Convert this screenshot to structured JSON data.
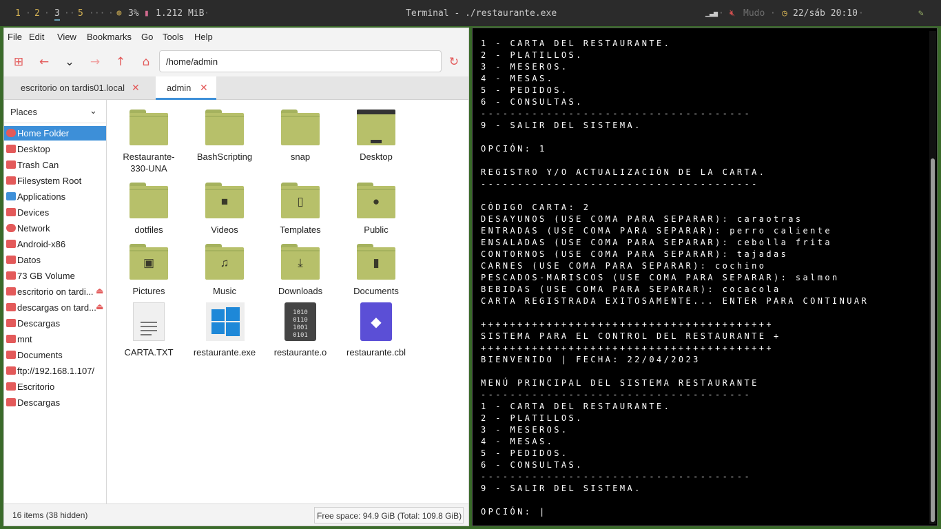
{
  "topbar": {
    "workspaces": [
      "1",
      "2",
      "3",
      "5"
    ],
    "active_workspace": "3",
    "cpu": "3%",
    "memory": "1.212 MiB",
    "window_title": "Terminal - ./restaurante.exe",
    "volume": "Mudo",
    "datetime": "22/sáb 20:10"
  },
  "file_manager": {
    "menu": [
      "File",
      "Edit",
      "View",
      "Bookmarks",
      "Go",
      "Tools",
      "Help"
    ],
    "address": "/home/admin",
    "tabs": [
      "escritorio on tardis01.local",
      "admin"
    ],
    "places_header": "Places",
    "places": [
      {
        "label": "Home Folder",
        "icon": "home-icon",
        "selected": true
      },
      {
        "label": "Desktop",
        "icon": "desktop-icon"
      },
      {
        "label": "Trash Can",
        "icon": "trash-icon"
      },
      {
        "label": "Filesystem Root",
        "icon": "folder-icon"
      },
      {
        "label": "Applications",
        "icon": "applications-icon"
      },
      {
        "label": "Devices",
        "icon": "monitor-icon"
      },
      {
        "label": "Network",
        "icon": "network-icon"
      },
      {
        "label": "Android-x86",
        "icon": "drive-icon"
      },
      {
        "label": "Datos",
        "icon": "drive-icon"
      },
      {
        "label": "73 GB Volume",
        "icon": "drive-icon"
      },
      {
        "label": "escritorio on tardi...",
        "icon": "network-share-icon",
        "eject": true
      },
      {
        "label": "descargas on tard...",
        "icon": "network-share-icon",
        "eject": true
      },
      {
        "label": "Descargas",
        "icon": "folder-icon"
      },
      {
        "label": "mnt",
        "icon": "folder-icon"
      },
      {
        "label": "Documents",
        "icon": "folder-icon"
      },
      {
        "label": "ftp://192.168.1.107/",
        "icon": "folder-icon"
      },
      {
        "label": "Escritorio",
        "icon": "folder-icon"
      },
      {
        "label": "Descargas",
        "icon": "folder-icon"
      }
    ],
    "items": [
      {
        "label": "Restaurante-330-UNA",
        "type": "folder"
      },
      {
        "label": "BashScripting",
        "type": "folder"
      },
      {
        "label": "snap",
        "type": "folder"
      },
      {
        "label": "Desktop",
        "type": "desktop-folder"
      },
      {
        "label": "dotfiles",
        "type": "folder"
      },
      {
        "label": "Videos",
        "type": "videos-folder"
      },
      {
        "label": "Templates",
        "type": "templates-folder"
      },
      {
        "label": "Public",
        "type": "public-folder"
      },
      {
        "label": "Pictures",
        "type": "pictures-folder"
      },
      {
        "label": "Music",
        "type": "music-folder"
      },
      {
        "label": "Downloads",
        "type": "downloads-folder"
      },
      {
        "label": "Documents",
        "type": "documents-folder"
      },
      {
        "label": "CARTA.TXT",
        "type": "text-file"
      },
      {
        "label": "restaurante.exe",
        "type": "exe-file"
      },
      {
        "label": "restaurante.o",
        "type": "object-file"
      },
      {
        "label": "restaurante.cbl",
        "type": "cobol-file"
      }
    ],
    "status_left": "16 items (38 hidden)",
    "status_right": "Free space: 94.9 GiB (Total: 109.8 GiB)"
  },
  "terminal": {
    "lines": [
      "1 - CARTA DEL RESTAURANTE.",
      "2 - PLATILLOS.",
      "3 - MESEROS.",
      "4 - MESAS.",
      "5 - PEDIDOS.",
      "6 - CONSULTAS.",
      "-------------------------------------",
      "9 - SALIR DEL SISTEMA.",
      "",
      "OPCIÓN: 1",
      "",
      "REGISTRO Y/O ACTUALIZACIÓN DE LA CARTA.",
      "--------------------------------------",
      "",
      "CÓDIGO CARTA: 2",
      "DESAYUNOS (USE COMA PARA SEPARAR): caraotras",
      "ENTRADAS (USE COMA PARA SEPARAR): perro caliente",
      "ENSALADAS (USE COMA PARA SEPARAR): cebolla frita",
      "CONTORNOS (USE COMA PARA SEPARAR): tajadas",
      "CARNES (USE COMA PARA SEPARAR): cochino",
      "PESCADOS-MARISCOS (USE COMA PARA SEPARAR): salmon",
      "BEBIDAS (USE COMA PARA SEPARAR): cocacola",
      "CARTA REGISTRADA EXITOSAMENTE... ENTER PARA CONTINUAR",
      "",
      "++++++++++++++++++++++++++++++++++++++++",
      "SISTEMA PARA EL CONTROL DEL RESTAURANTE +",
      "++++++++++++++++++++++++++++++++++++++++",
      "BIENVENIDO | FECHA: 22/04/2023",
      "",
      "MENÚ PRINCIPAL DEL SISTEMA RESTAURANTE",
      "-------------------------------------",
      "1 - CARTA DEL RESTAURANTE.",
      "2 - PLATILLOS.",
      "3 - MESEROS.",
      "4 - MESAS.",
      "5 - PEDIDOS.",
      "6 - CONSULTAS.",
      "-------------------------------------",
      "9 - SALIR DEL SISTEMA.",
      "",
      "OPCIÓN: |"
    ]
  }
}
